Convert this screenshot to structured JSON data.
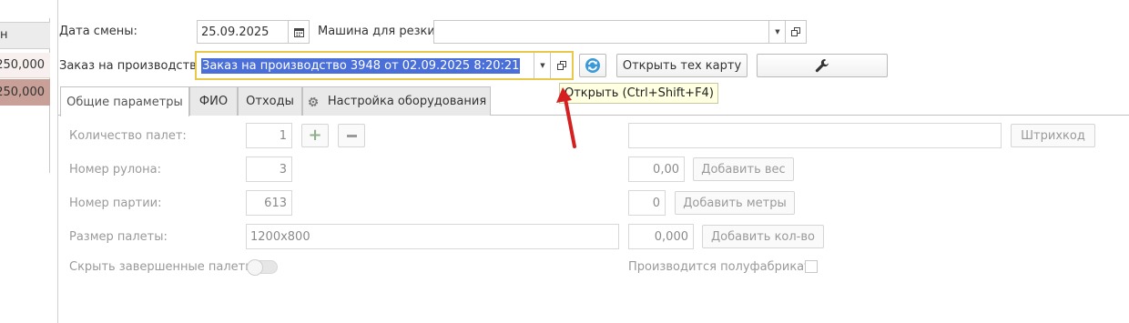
{
  "left_panel": {
    "header_fragment": "н",
    "rows": [
      "250,000",
      "250,000"
    ]
  },
  "top": {
    "shift_date_label": "Дата смены:",
    "shift_date_value": "25.09.2025",
    "machine_label": "Машина для резки:",
    "machine_value": "",
    "order_label": "Заказ на производство:",
    "order_value": "Заказ на производство 3948 от 02.09.2025 8:20:21",
    "open_tech_card_label": "Открыть тех карту",
    "tooltip": "Открыть (Ctrl+Shift+F4)"
  },
  "tabs": [
    {
      "label": "Общие параметры",
      "active": true
    },
    {
      "label": "ФИО",
      "active": false
    },
    {
      "label": "Отходы",
      "active": false
    },
    {
      "label": "Настройка оборудования",
      "active": false
    }
  ],
  "form": {
    "pallet_count_label": "Количество палет:",
    "pallet_count_value": "1",
    "roll_number_label": "Номер рулона:",
    "roll_number_value": "3",
    "batch_number_label": "Номер партии:",
    "batch_number_value": "613",
    "pallet_size_label": "Размер палеты:",
    "pallet_size_value": "1200x800",
    "hide_finished_label": "Скрыть завершенные палеты:",
    "barcode_value": "",
    "barcode_button": "Штрихкод",
    "weight_value": "0,00",
    "add_weight_button": "Добавить вес",
    "meters_value": "0",
    "add_meters_button": "Добавить метры",
    "qty_value": "0,000",
    "add_qty_button": "Добавить кол-во",
    "semi_finished_label": "Производится полуфабрикат:"
  },
  "colors": {
    "order_highlight": "#4a6fd8",
    "order_border": "#e8c84a",
    "tooltip_bg": "#ffffe1",
    "arrow": "#d42020",
    "left_row_selected": "#c9a097"
  }
}
